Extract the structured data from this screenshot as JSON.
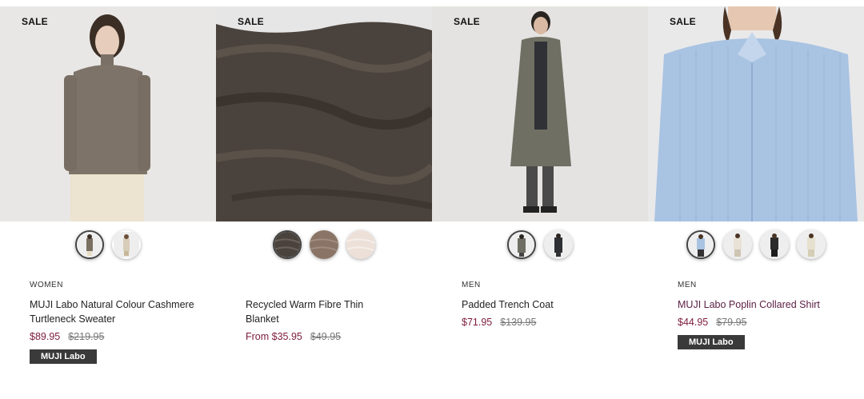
{
  "products": [
    {
      "sale_label": "SALE",
      "category": "WOMEN",
      "title": "MUJI Labo Natural Colour Cashmere Turtleneck Sweater",
      "price_now": "$89.95",
      "price_was": "$219.95",
      "badge": "MUJI Labo",
      "swatch_colors": [
        "#7a6f62",
        "#d8cdb8"
      ]
    },
    {
      "sale_label": "SALE",
      "category": "",
      "title": "Recycled Warm Fibre Thin Blanket",
      "price_now": "From $35.95",
      "price_was": "$49.95",
      "badge": "",
      "swatch_colors": [
        "#4a433d",
        "#8a7466",
        "#e9d8cf"
      ]
    },
    {
      "sale_label": "SALE",
      "category": "MEN",
      "title": "Padded Trench Coat",
      "price_now": "$71.95",
      "price_was": "$139.95",
      "badge": "",
      "swatch_colors": [
        "#6e6e64",
        "#2d2f33"
      ]
    },
    {
      "sale_label": "SALE",
      "category": "MEN",
      "title": "MUJI Labo Poplin Collared Shirt",
      "price_now": "$44.95",
      "price_was": "$79.95",
      "badge": "MUJI Labo",
      "swatch_colors": [
        "#a9c3e2",
        "#e8e2d6",
        "#2b2b2b",
        "#e6e1cf"
      ]
    }
  ]
}
